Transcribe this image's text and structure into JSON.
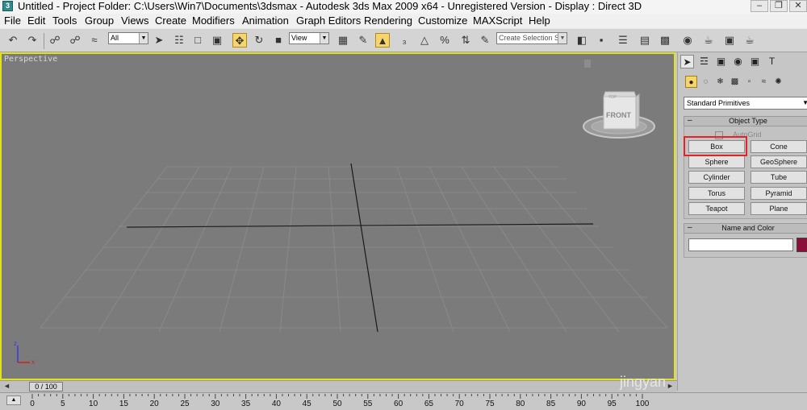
{
  "window": {
    "title": "Untitled     - Project Folder: C:\\Users\\Win7\\Documents\\3dsmax     - Autodesk 3ds Max  2009 x64   - Unregistered Version     - Display : Direct 3D",
    "app_icon_letter": "3"
  },
  "menu": [
    "File",
    "Edit",
    "Tools",
    "Group",
    "Views",
    "Create",
    "Modifiers",
    "Animation",
    "Graph Editors",
    "Rendering",
    "Customize",
    "MAXScript",
    "Help"
  ],
  "toolbar": {
    "selection_filter": "All",
    "reference_coord": "View",
    "named_selection_placeholder": "Create Selection Se",
    "active_tool": "select-and-move"
  },
  "viewport": {
    "label": "Perspective",
    "viewcube_face": "FRONT",
    "viewcube_top": "TOP",
    "axis_x": "x",
    "axis_z": "z",
    "border_color": "#e2e21a"
  },
  "command_panel": {
    "category": "Standard Primitives",
    "object_type_title": "Object Type",
    "autogrid_label": "AutoGrid",
    "buttons": [
      "Box",
      "Cone",
      "Sphere",
      "GeoSphere",
      "Cylinder",
      "Tube",
      "Torus",
      "Pyramid",
      "Teapot",
      "Plane"
    ],
    "highlighted_button": "Box",
    "name_color_title": "Name and Color",
    "name_value": "",
    "object_color": "#8a0f3a"
  },
  "timeline": {
    "slider_label": "0 / 100",
    "ticks": [
      "0",
      "5",
      "10",
      "15",
      "20",
      "25",
      "30",
      "35",
      "40",
      "45",
      "50",
      "55",
      "60",
      "65",
      "70",
      "75",
      "80",
      "85",
      "90",
      "95",
      "100"
    ]
  },
  "watermark": "jingyan"
}
